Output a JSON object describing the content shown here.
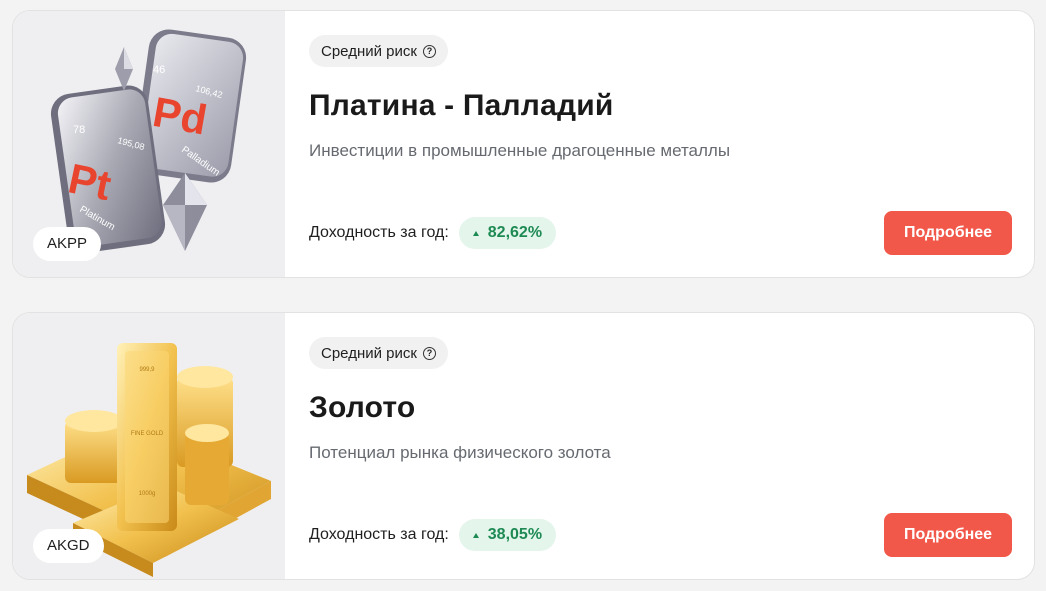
{
  "funds": [
    {
      "ticker": "AKPP",
      "risk": "Средний риск",
      "title": "Платина - Палладий",
      "description": "Инвестиции в промышленные драгоценные металлы",
      "yield_label": "Доходность за год:",
      "yield_value": "82,62%",
      "button_label": "Подробнее",
      "tiles": [
        {
          "number": "46",
          "symbol": "Pd",
          "mass": "106,42",
          "name": "Palladium"
        },
        {
          "number": "78",
          "symbol": "Pt",
          "mass": "195,08",
          "name": "Platinum"
        }
      ]
    },
    {
      "ticker": "AKGD",
      "risk": "Средний риск",
      "title": "Золото",
      "description": "Потенциал рынка физического золота",
      "yield_label": "Доходность за год:",
      "yield_value": "38,05%",
      "button_label": "Подробнее",
      "bar_marks": [
        "999,9",
        "FINE GOLD",
        "1000g"
      ]
    }
  ],
  "colors": {
    "accent_button": "#f2584a",
    "yield_positive_text": "#1e8a53",
    "yield_positive_bg": "#e4f5ec"
  }
}
